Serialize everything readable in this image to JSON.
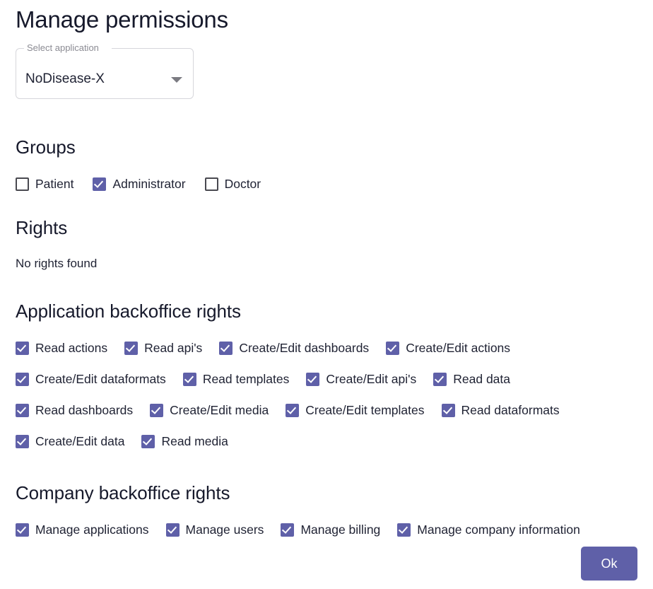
{
  "page": {
    "title": "Manage permissions"
  },
  "application_select": {
    "label": "Select application",
    "value": "NoDisease-X",
    "arrow_icon": "chevron-down-icon"
  },
  "groups": {
    "heading": "Groups",
    "items": [
      {
        "label": "Patient",
        "checked": false
      },
      {
        "label": "Administrator",
        "checked": true
      },
      {
        "label": "Doctor",
        "checked": false
      }
    ]
  },
  "rights": {
    "heading": "Rights",
    "empty_text": "No rights found"
  },
  "application_backoffice_rights": {
    "heading": "Application backoffice rights",
    "items": [
      {
        "label": "Read actions",
        "checked": true
      },
      {
        "label": "Read api's",
        "checked": true
      },
      {
        "label": "Create/Edit dashboards",
        "checked": true
      },
      {
        "label": "Create/Edit actions",
        "checked": true
      },
      {
        "label": "Create/Edit dataformats",
        "checked": true
      },
      {
        "label": "Read templates",
        "checked": true
      },
      {
        "label": "Create/Edit api's",
        "checked": true
      },
      {
        "label": "Read data",
        "checked": true
      },
      {
        "label": "Read dashboards",
        "checked": true
      },
      {
        "label": "Create/Edit media",
        "checked": true
      },
      {
        "label": "Create/Edit templates",
        "checked": true
      },
      {
        "label": "Read dataformats",
        "checked": true
      },
      {
        "label": "Create/Edit data",
        "checked": true
      },
      {
        "label": "Read media",
        "checked": true
      }
    ]
  },
  "company_backoffice_rights": {
    "heading": "Company backoffice rights",
    "items": [
      {
        "label": "Manage applications",
        "checked": true
      },
      {
        "label": "Manage users",
        "checked": true
      },
      {
        "label": "Manage billing",
        "checked": true
      },
      {
        "label": "Manage company information",
        "checked": true
      }
    ]
  },
  "footer": {
    "ok_label": "Ok"
  },
  "colors": {
    "accent": "#5f60a8",
    "text": "#1f2233",
    "muted": "#8b8b93",
    "border": "#d6d6db"
  }
}
